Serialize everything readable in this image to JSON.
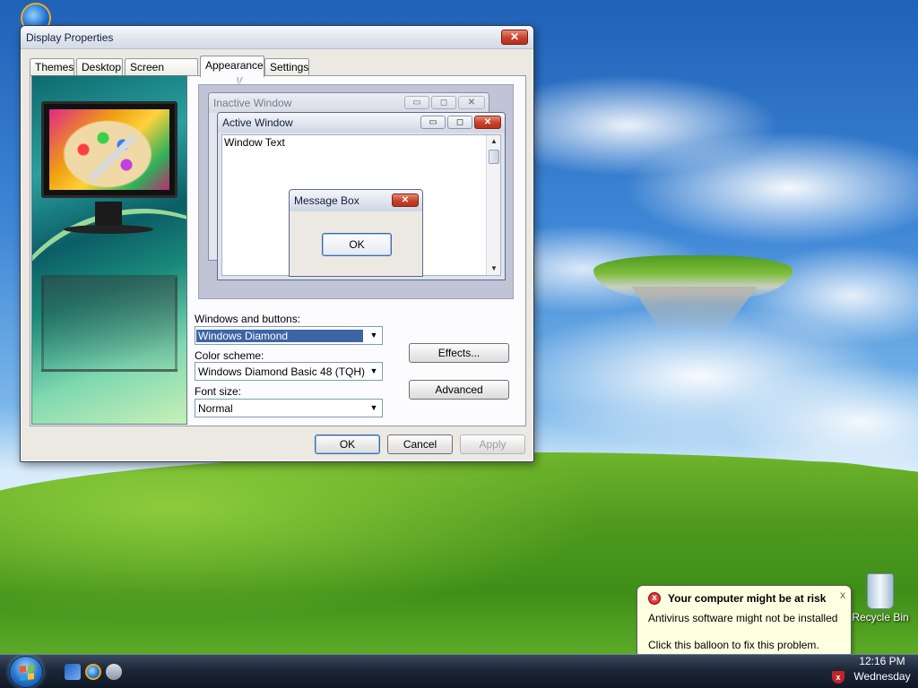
{
  "desktop": {
    "icons": [
      {
        "name": "internet-explorer",
        "label": ""
      },
      {
        "name": "recycle-bin",
        "label": "Recycle Bin"
      }
    ]
  },
  "dialog": {
    "title": "Display Properties",
    "close_glyph": "✕",
    "tabs": [
      {
        "label": "Themes"
      },
      {
        "label": "Desktop"
      },
      {
        "label": "Screen Saver"
      },
      {
        "label": "Appearance",
        "active": true
      },
      {
        "label": "Settings"
      }
    ],
    "preview": {
      "inactive_title": "Inactive Window",
      "active_title": "Active Window",
      "window_text": "Window Text",
      "message_box_title": "Message Box",
      "message_box_ok": "OK",
      "caption_min": "▭",
      "caption_max": "◻",
      "caption_close": "✕",
      "scroll_up": "▲",
      "scroll_down": "▼"
    },
    "windows_and_buttons": {
      "label": "Windows and buttons:",
      "value": "Windows Diamond"
    },
    "color_scheme": {
      "label": "Color scheme:",
      "value": "Windows Diamond Basic 48 (TQH)"
    },
    "font_size": {
      "label": "Font size:",
      "value": "Normal"
    },
    "dropdown_arrow": "▼",
    "effects_button": "Effects...",
    "advanced_button": "Advanced",
    "ok_button": "OK",
    "cancel_button": "Cancel",
    "apply_button": "Apply"
  },
  "balloon": {
    "title": "Your computer might be at risk",
    "line1": "Antivirus software might not be installed",
    "line2": "Click this balloon to fix this problem.",
    "close_glyph": "x",
    "icon_glyph": "x"
  },
  "taskbar": {
    "time": "12:16 PM",
    "day": "Wednesday",
    "tray_icon_glyph": "x"
  },
  "colors": {
    "accent": "#3e64a6",
    "close_red": "#c9402a",
    "balloon_bg": "#ffffe1",
    "taskbar": "#1c2738"
  }
}
